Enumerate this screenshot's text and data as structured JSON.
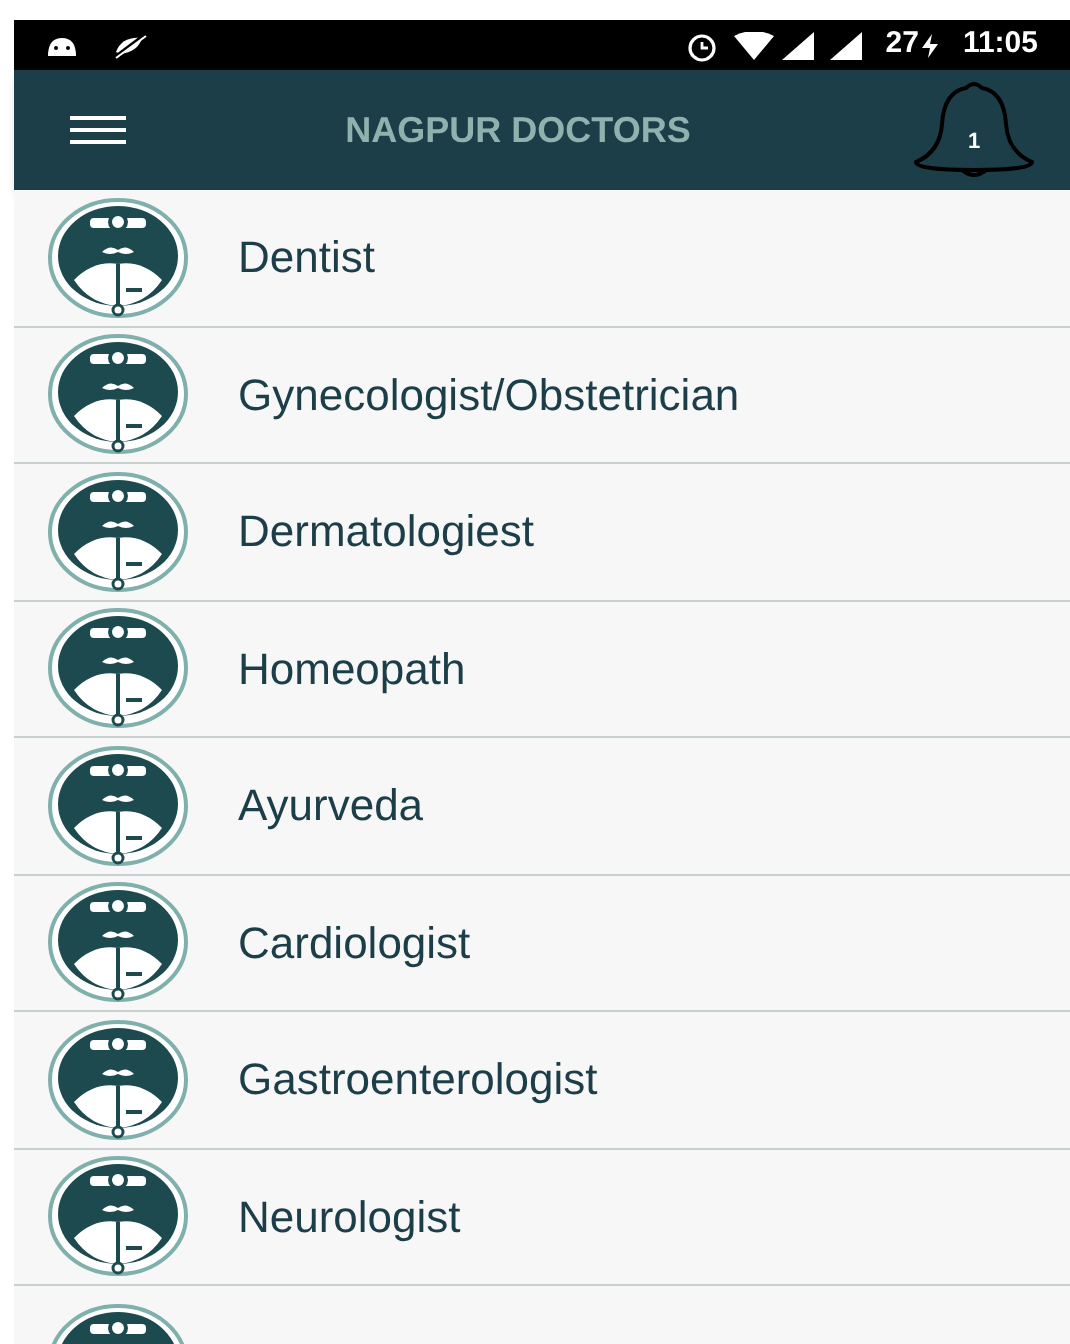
{
  "status_bar": {
    "battery": "27",
    "time": "11:05"
  },
  "app_bar": {
    "title": "NAGPUR DOCTORS",
    "notification_count": "1"
  },
  "categories": [
    {
      "label": "Dentist"
    },
    {
      "label": "Gynecologist/Obstetrician"
    },
    {
      "label": "Dermatologiest"
    },
    {
      "label": "Homeopath"
    },
    {
      "label": "Ayurveda"
    },
    {
      "label": "Cardiologist"
    },
    {
      "label": "Gastroenterologist"
    },
    {
      "label": "Neurologist"
    }
  ],
  "more_rows_below": true
}
